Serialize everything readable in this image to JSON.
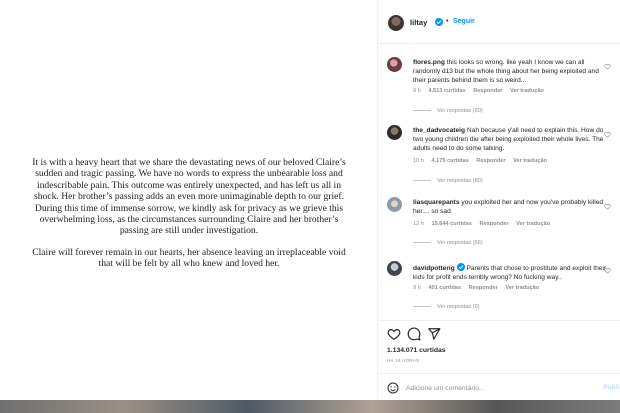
{
  "post": {
    "paragraph_1": [
      "It is with a heavy heart that we share the devastating news of our beloved Claire’s",
      "sudden and tragic passing. We have no words to express the unbearable loss and",
      "indescribable pain. This outcome was entirely unexpected, and has left us all in",
      "shock. Her brother’s passing adds an even more unimaginable depth to our grief.",
      "During this time of immense sorrow, we kindly ask for privacy as we grieve this",
      "overwhelming loss, as the circumstances surrounding Claire and her brother’s",
      "passing are still under investigation."
    ],
    "paragraph_2": [
      "Claire will forever remain in our hearts, her absence leaving an irreplaceable void",
      "that will be felt by all who knew and loved her."
    ]
  },
  "header": {
    "handle": "liltay",
    "dot": "•",
    "follow_label": "Seguir"
  },
  "comments": [
    {
      "user": "flores.png",
      "text": "this looks so wrong. like yeah I know we can all randomly d13 but the whole thing about her being exploited and their parents behind them is so weird...",
      "time": "9 h",
      "likes": "4.513 curtidas",
      "reply": "Responder",
      "translate": "Ver tradução",
      "replies": "Ver respostas (60)"
    },
    {
      "user": "the_dadvocateig",
      "text": "Nah because y'all need to explain this. How do two young children die after being exploited their whole lives. The adults need to do some talking.",
      "time": "10 h",
      "likes": "4.175 curtidas",
      "reply": "Responder",
      "translate": "Ver tradução",
      "replies": "Ver respostas (80)"
    },
    {
      "user": "liasquarepants",
      "text": "you exploited her and now you've probably killed her.... so sad",
      "time": "12 h",
      "likes": "15.644 curtidas",
      "reply": "Responder",
      "translate": "Ver tradução",
      "replies": "Ver respostas (56)"
    },
    {
      "user": "davidpotterig",
      "text": "Parents that chose to prostitute and exploit their kids for profit ends terribly wrong? No fucking way..",
      "time": "9 h",
      "likes": "401 curtidas",
      "reply": "Responder",
      "translate": "Ver tradução",
      "replies": "Ver respostas (9)"
    }
  ],
  "actions": {
    "likes": "1.134.071 curtidas",
    "time": "HÁ 18 HORAS",
    "comment_placeholder": "Adicione um comentário...",
    "publish_label": "Publi"
  },
  "icons": {
    "like": "heart-icon",
    "comment": "comment-icon",
    "share": "send-icon",
    "emoji": "emoji-icon",
    "verified": "verified-badge-icon"
  },
  "colors": {
    "accent": "#0095f6",
    "muted": "#8e8e8e",
    "text": "#262626"
  }
}
